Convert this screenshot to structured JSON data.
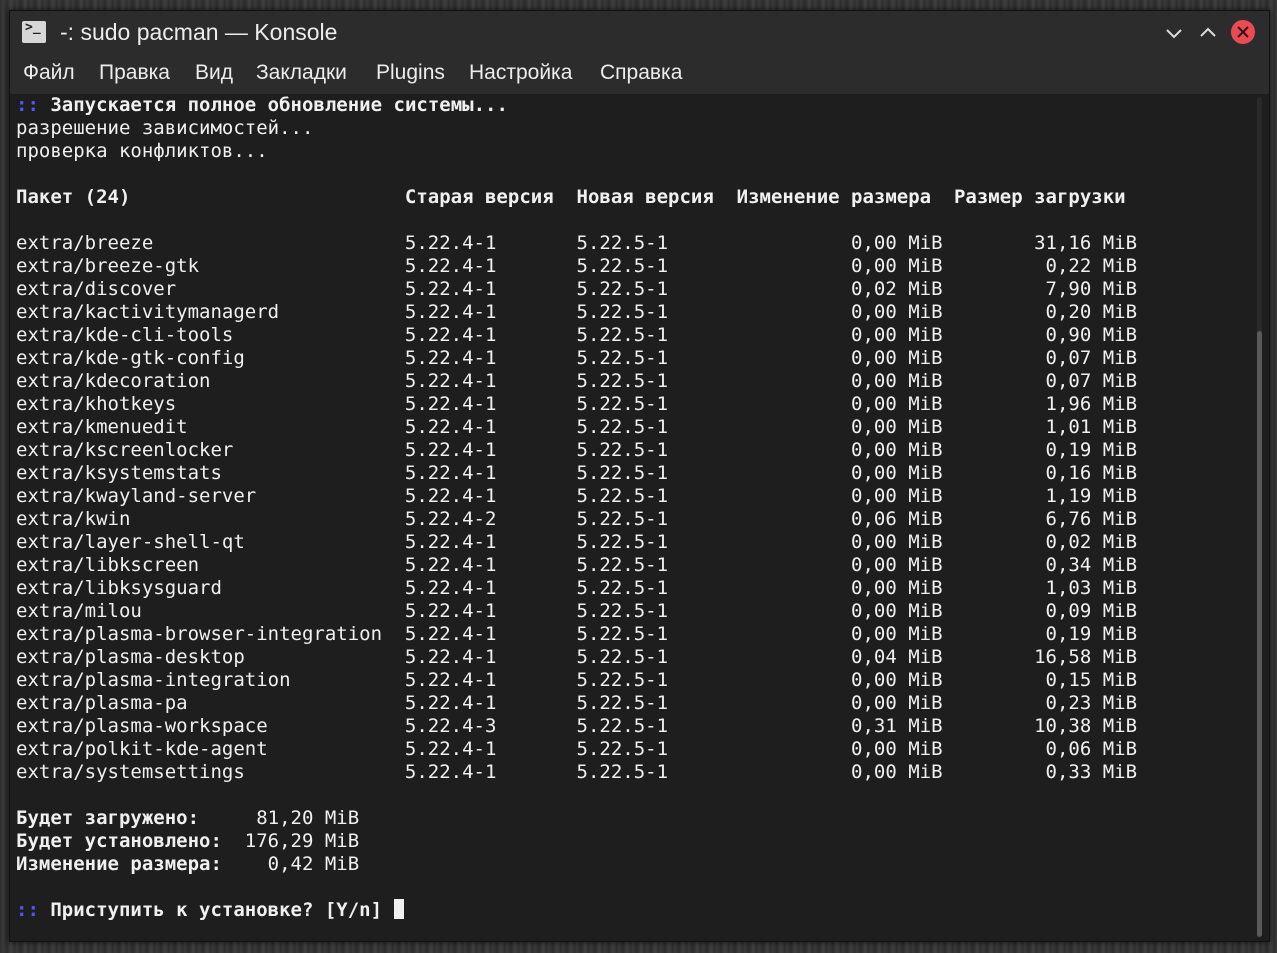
{
  "window": {
    "title": "-: sudo pacman — Konsole",
    "icon": "konsole-terminal-icon",
    "icon_glyph": ">_",
    "close_color": "#e94b55"
  },
  "menu": [
    "Файл",
    "Правка",
    "Вид",
    "Закладки",
    "Plugins",
    "Настройка",
    "Справка"
  ],
  "terminal": {
    "line1_prefix": "::",
    "line1_text": " Запускается полное обновление системы...",
    "line2": "разрешение зависимостей...",
    "line3": "проверка конфликтов...",
    "header": "Пакет (24)                        Старая версия  Новая версия  Изменение размера  Размер загрузки",
    "rows": [
      "extra/breeze                      5.22.4-1       5.22.5-1                0,00 MiB        31,16 MiB",
      "extra/breeze-gtk                  5.22.4-1       5.22.5-1                0,00 MiB         0,22 MiB",
      "extra/discover                    5.22.4-1       5.22.5-1                0,02 MiB         7,90 MiB",
      "extra/kactivitymanagerd           5.22.4-1       5.22.5-1                0,00 MiB         0,20 MiB",
      "extra/kde-cli-tools               5.22.4-1       5.22.5-1                0,00 MiB         0,90 MiB",
      "extra/kde-gtk-config              5.22.4-1       5.22.5-1                0,00 MiB         0,07 MiB",
      "extra/kdecoration                 5.22.4-1       5.22.5-1                0,00 MiB         0,07 MiB",
      "extra/khotkeys                    5.22.4-1       5.22.5-1                0,00 MiB         1,96 MiB",
      "extra/kmenuedit                   5.22.4-1       5.22.5-1                0,00 MiB         1,01 MiB",
      "extra/kscreenlocker               5.22.4-1       5.22.5-1                0,00 MiB         0,19 MiB",
      "extra/ksystemstats                5.22.4-1       5.22.5-1                0,00 MiB         0,16 MiB",
      "extra/kwayland-server             5.22.4-1       5.22.5-1                0,00 MiB         1,19 MiB",
      "extra/kwin                        5.22.4-2       5.22.5-1                0,06 MiB         6,76 MiB",
      "extra/layer-shell-qt              5.22.4-1       5.22.5-1                0,00 MiB         0,02 MiB",
      "extra/libkscreen                  5.22.4-1       5.22.5-1                0,00 MiB         0,34 MiB",
      "extra/libksysguard                5.22.4-1       5.22.5-1                0,00 MiB         1,03 MiB",
      "extra/milou                       5.22.4-1       5.22.5-1                0,00 MiB         0,09 MiB",
      "extra/plasma-browser-integration  5.22.4-1       5.22.5-1                0,00 MiB         0,19 MiB",
      "extra/plasma-desktop              5.22.4-1       5.22.5-1                0,04 MiB        16,58 MiB",
      "extra/plasma-integration          5.22.4-1       5.22.5-1                0,00 MiB         0,15 MiB",
      "extra/plasma-pa                   5.22.4-1       5.22.5-1                0,00 MiB         0,23 MiB",
      "extra/plasma-workspace            5.22.4-3       5.22.5-1                0,31 MiB        10,38 MiB",
      "extra/polkit-kde-agent            5.22.4-1       5.22.5-1                0,00 MiB         0,06 MiB",
      "extra/systemsettings              5.22.4-1       5.22.5-1                0,00 MiB         0,33 MiB"
    ],
    "summary_download_label": "Будет загружено:",
    "summary_download_value": "     81,20 MiB",
    "summary_install_label": "Будет установлено:",
    "summary_install_value": "  176,29 MiB",
    "summary_change_label": "Изменение размера:",
    "summary_change_value": "    0,42 MiB",
    "prompt_prefix": "::",
    "prompt_text": " Приступить к установке? [Y/n] "
  }
}
